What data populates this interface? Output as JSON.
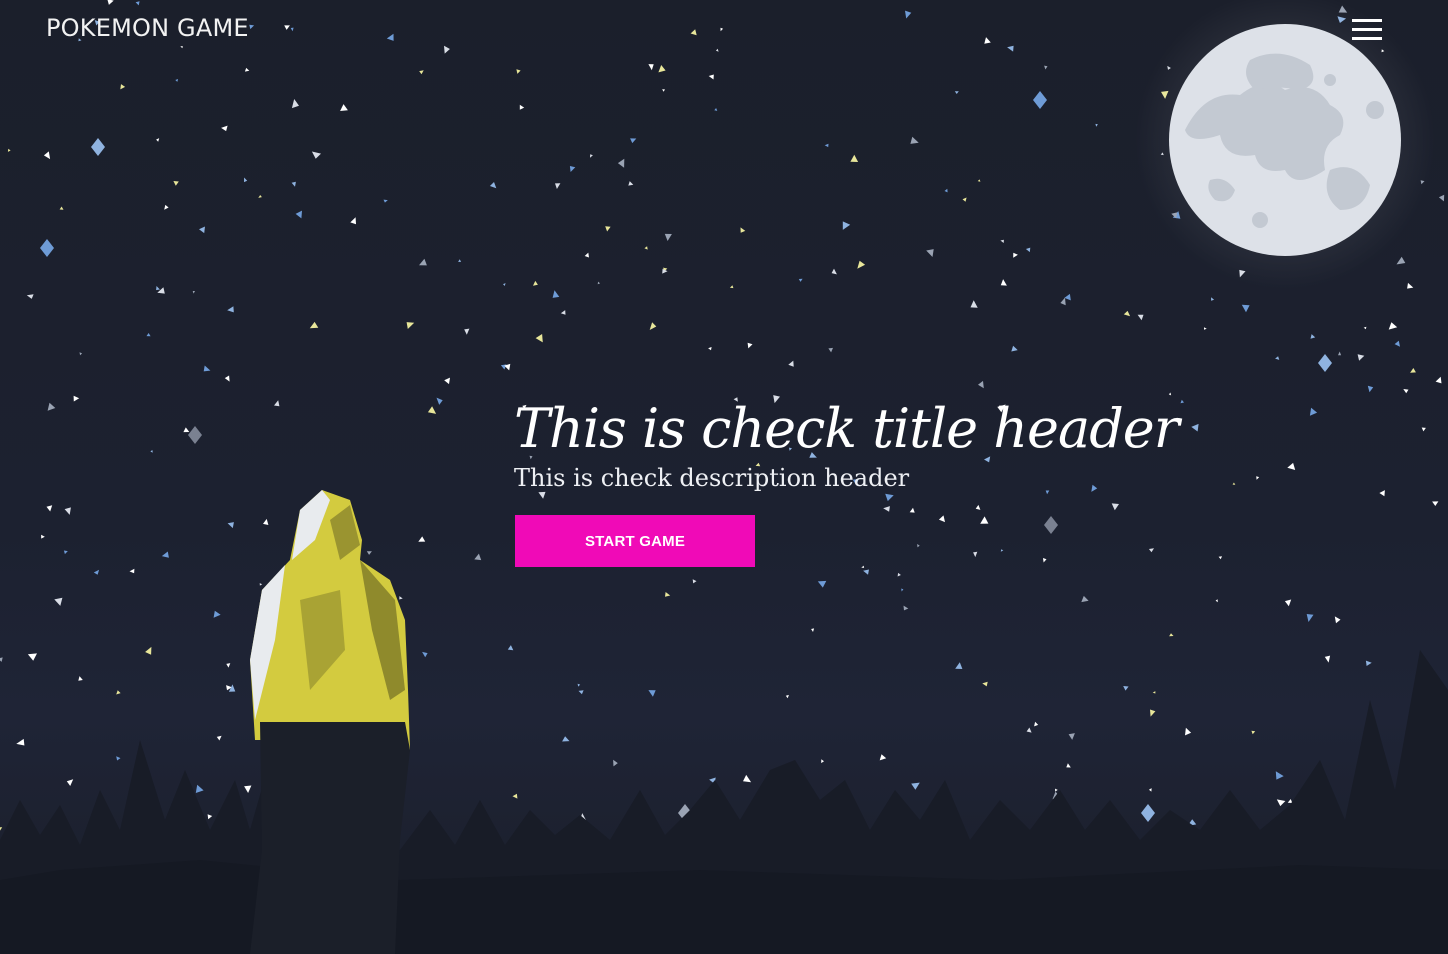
{
  "header": {
    "brand": "POKEMON GAME",
    "menu_icon": "hamburger-menu-icon"
  },
  "hero": {
    "title": "This is check title header",
    "description": "This is check description header",
    "cta_label": "START GAME"
  },
  "illustration": {
    "moon_icon": "moon-icon",
    "figure_icon": "hooded-person-icon",
    "trees_icon": "pine-trees-icon"
  },
  "colors": {
    "background": "#1c2130",
    "accent": "#f00ab7",
    "hoodie": "#d3cb3f",
    "moon": "#dde1e8"
  }
}
